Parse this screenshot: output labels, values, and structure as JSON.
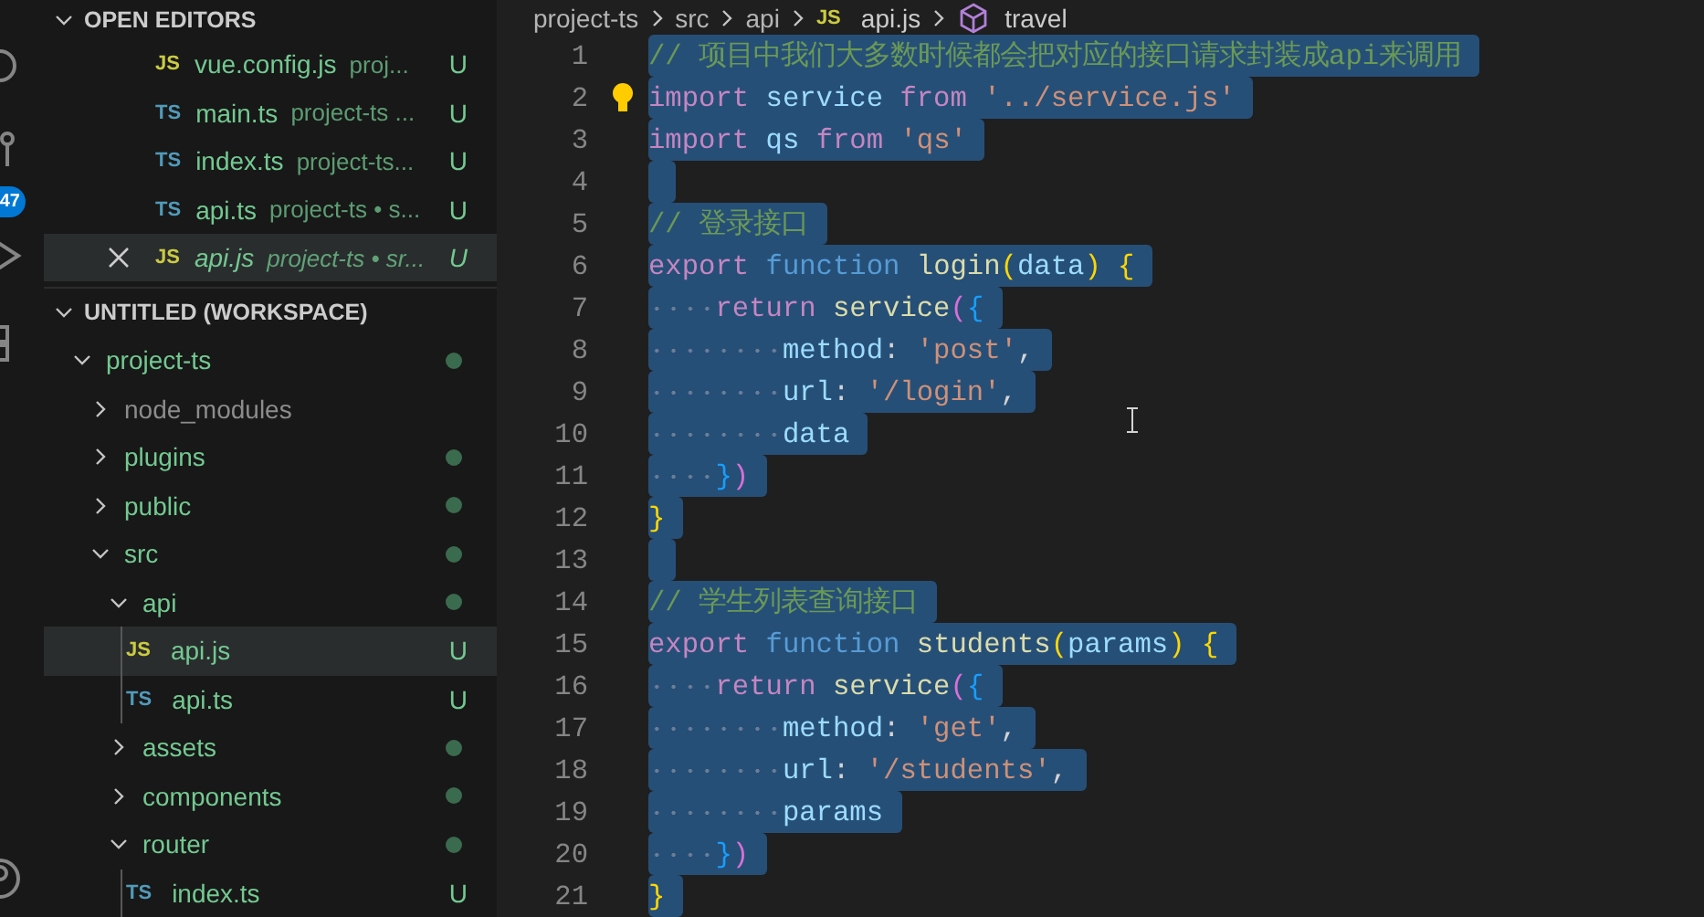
{
  "activity_bar": {
    "badge": "47"
  },
  "open_editors": {
    "title": "OPEN EDITORS",
    "files": [
      {
        "color": "#cbcb41",
        "icon_label": "JS",
        "name": "vue.config.js",
        "description": "proj...",
        "status": "U",
        "selected": false
      },
      {
        "color": "#519aba",
        "icon_label": "TS",
        "name": "main.ts",
        "description": "project-ts ...",
        "status": "U",
        "selected": false
      },
      {
        "color": "#519aba",
        "icon_label": "TS",
        "name": "index.ts",
        "description": "project-ts...",
        "status": "U",
        "selected": false
      },
      {
        "color": "#519aba",
        "icon_label": "TS",
        "name": "api.ts",
        "description": "project-ts • s...",
        "status": "U",
        "selected": false
      },
      {
        "color": "#cbcb41",
        "icon_label": "JS",
        "name": "api.js",
        "description": "project-ts • sr...",
        "status": "U",
        "selected": true
      }
    ]
  },
  "workspace": {
    "title": "UNTITLED (WORKSPACE)",
    "tree": [
      {
        "kind": "folder",
        "name": "project-ts",
        "expanded": true,
        "ignored": false,
        "selected": false,
        "children": [
          {
            "kind": "folder",
            "name": "node_modules",
            "expanded": false,
            "ignored": true,
            "selected": false
          },
          {
            "kind": "folder",
            "name": "plugins",
            "expanded": false,
            "ignored": false,
            "selected": false
          },
          {
            "kind": "folder",
            "name": "public",
            "expanded": false,
            "ignored": false,
            "selected": false
          },
          {
            "kind": "folder",
            "name": "src",
            "expanded": true,
            "ignored": false,
            "selected": false,
            "children": [
              {
                "kind": "folder",
                "name": "api",
                "expanded": true,
                "ignored": false,
                "selected": false,
                "children": [
                  {
                    "kind": "file",
                    "color": "#cbcb41",
                    "icon_label": "JS",
                    "name": "api.js",
                    "status": "U",
                    "ignored": false,
                    "selected": true
                  },
                  {
                    "kind": "file",
                    "color": "#519aba",
                    "icon_label": "TS",
                    "name": "api.ts",
                    "status": "U",
                    "ignored": false,
                    "selected": false
                  }
                ]
              },
              {
                "kind": "folder",
                "name": "assets",
                "expanded": false,
                "ignored": false,
                "selected": false
              },
              {
                "kind": "folder",
                "name": "components",
                "expanded": false,
                "ignored": false,
                "selected": false
              },
              {
                "kind": "folder",
                "name": "router",
                "expanded": true,
                "ignored": false,
                "selected": false,
                "children": [
                  {
                    "kind": "file",
                    "color": "#519aba",
                    "icon_label": "TS",
                    "name": "index.ts",
                    "status": "U",
                    "ignored": false,
                    "selected": false
                  }
                ]
              }
            ]
          }
        ]
      }
    ]
  },
  "breadcrumbs": [
    {
      "kind": "folder",
      "label": "project-ts"
    },
    {
      "kind": "folder",
      "label": "src"
    },
    {
      "kind": "folder",
      "label": "api"
    },
    {
      "kind": "file",
      "color": "#cbcb41",
      "icon_label": "JS",
      "label": "api.js"
    },
    {
      "kind": "symbol",
      "label": "travel"
    }
  ],
  "code_lines": [
    {
      "number": "1",
      "selected": true,
      "tokens": [
        {
          "kind": "comment",
          "text": "// 项目中我们大多数时候都会把对应的接口请求封装成api来调用"
        }
      ]
    },
    {
      "number": "2",
      "selected": true,
      "lightbulb": true,
      "tokens": [
        {
          "kind": "keyword",
          "text": "import "
        },
        {
          "kind": "variable",
          "text": "service "
        },
        {
          "kind": "keyword",
          "text": "from "
        },
        {
          "kind": "string",
          "text": "'../service.js'"
        }
      ]
    },
    {
      "number": "3",
      "selected": true,
      "tokens": [
        {
          "kind": "keyword",
          "text": "import "
        },
        {
          "kind": "variable",
          "text": "qs "
        },
        {
          "kind": "keyword",
          "text": "from "
        },
        {
          "kind": "string",
          "text": "'qs'"
        }
      ]
    },
    {
      "number": "4",
      "selected": true
    },
    {
      "number": "5",
      "selected": true,
      "tokens": [
        {
          "kind": "comment",
          "text": "// 登录接口"
        }
      ]
    },
    {
      "number": "6",
      "selected": true,
      "tokens": [
        {
          "kind": "keyword",
          "text": "export "
        },
        {
          "kind": "storage",
          "text": "function "
        },
        {
          "kind": "function",
          "text": "login"
        },
        {
          "kind": "bracket1",
          "text": "("
        },
        {
          "kind": "variable",
          "text": "data"
        },
        {
          "kind": "bracket1",
          "text": ") {"
        }
      ]
    },
    {
      "number": "7",
      "selected": true,
      "tokens": [
        {
          "kind": "keyword",
          "text": "    return "
        },
        {
          "kind": "function",
          "text": "service"
        },
        {
          "kind": "bracket2",
          "text": "("
        },
        {
          "kind": "bracket3",
          "text": "{"
        }
      ]
    },
    {
      "number": "8",
      "selected": true,
      "tokens": [
        {
          "kind": "variable",
          "text": "        method"
        },
        {
          "kind": "plain",
          "text": ": "
        },
        {
          "kind": "string",
          "text": "'post'"
        },
        {
          "kind": "plain",
          "text": ","
        }
      ]
    },
    {
      "number": "9",
      "selected": true,
      "tokens": [
        {
          "kind": "variable",
          "text": "        url"
        },
        {
          "kind": "plain",
          "text": ": "
        },
        {
          "kind": "string",
          "text": "'/login'"
        },
        {
          "kind": "plain",
          "text": ","
        }
      ]
    },
    {
      "number": "10",
      "selected": true,
      "tokens": [
        {
          "kind": "variable",
          "text": "        data"
        }
      ]
    },
    {
      "number": "11",
      "selected": true,
      "tokens": [
        {
          "kind": "bracket3",
          "text": "    }"
        },
        {
          "kind": "bracket2",
          "text": ")"
        }
      ]
    },
    {
      "number": "12",
      "selected": true,
      "tokens": [
        {
          "kind": "bracket1",
          "text": "}"
        }
      ]
    },
    {
      "number": "13",
      "selected": true
    },
    {
      "number": "14",
      "selected": true,
      "tokens": [
        {
          "kind": "comment",
          "text": "// 学生列表查询接口"
        }
      ]
    },
    {
      "number": "15",
      "selected": true,
      "tokens": [
        {
          "kind": "keyword",
          "text": "export "
        },
        {
          "kind": "storage",
          "text": "function "
        },
        {
          "kind": "function",
          "text": "students"
        },
        {
          "kind": "bracket1",
          "text": "("
        },
        {
          "kind": "variable",
          "text": "params"
        },
        {
          "kind": "bracket1",
          "text": ") {"
        }
      ]
    },
    {
      "number": "16",
      "selected": true,
      "tokens": [
        {
          "kind": "keyword",
          "text": "    return "
        },
        {
          "kind": "function",
          "text": "service"
        },
        {
          "kind": "bracket2",
          "text": "("
        },
        {
          "kind": "bracket3",
          "text": "{"
        }
      ]
    },
    {
      "number": "17",
      "selected": true,
      "tokens": [
        {
          "kind": "variable",
          "text": "        method"
        },
        {
          "kind": "plain",
          "text": ": "
        },
        {
          "kind": "string",
          "text": "'get'"
        },
        {
          "kind": "plain",
          "text": ","
        }
      ]
    },
    {
      "number": "18",
      "selected": true,
      "tokens": [
        {
          "kind": "variable",
          "text": "        url"
        },
        {
          "kind": "plain",
          "text": ": "
        },
        {
          "kind": "string",
          "text": "'/students'"
        },
        {
          "kind": "plain",
          "text": ","
        }
      ]
    },
    {
      "number": "19",
      "selected": true,
      "tokens": [
        {
          "kind": "variable",
          "text": "        params"
        }
      ]
    },
    {
      "number": "20",
      "selected": true,
      "tokens": [
        {
          "kind": "bracket3",
          "text": "    }"
        },
        {
          "kind": "bracket2",
          "text": ")"
        }
      ]
    },
    {
      "number": "21",
      "selected": true,
      "tokens": [
        {
          "kind": "bracket1",
          "text": "}"
        }
      ]
    }
  ]
}
